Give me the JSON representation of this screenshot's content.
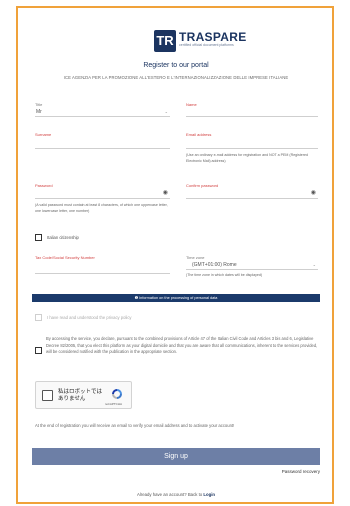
{
  "brand": {
    "logo_mark": "TR",
    "name": "TRASPARE",
    "tagline": "certified official document platforms"
  },
  "header": {
    "title": "Register to our portal",
    "subtitle": "ICE AGENZIA PER LA PROMOZIONE ALL'ESTERO E L'INTERNAZIONALIZZAZIONE DELLE IMPRESE ITALIANE"
  },
  "form": {
    "title_label": "Title",
    "title_value": "Mr",
    "name_label": "Name",
    "surname_label": "Surname",
    "email_label": "Email address",
    "email_hint": "(Use an ordinary e-mail address for registration and NOT a PEM (Registered Electronic Mail) address)",
    "password_label": "Password",
    "password_hint": "(A valid password must contain at least 8 characters, of which one uppercase letter, one lowercase letter, one number)",
    "confirm_password_label": "Confirm password",
    "italian_citizenship_label": "Italian citizenship",
    "tax_code_label": "Tax Code/Social Security Number",
    "timezone_label": "Time zone",
    "timezone_value": "(GMT+01:00) Rome",
    "timezone_hint": "(The time zone in which dates will be displayed)"
  },
  "privacy": {
    "info_bar": "Information on the processing of personal data",
    "read_label": "I have read and understood the privacy policy",
    "consent_text": "By accessing the service, you declare, pursuant to the combined provisions of Article 47 of the Italian Civil Code and Articles 3 bis and 6, Legislative Decree 82/2005, that you elect this platform as your digital domicile and that you are aware that all communications, inherent to the services provided, will be considered notified with the publication in the appropriate section."
  },
  "captcha": {
    "text": "私はロボットではありません",
    "brand": "reCAPTCHA"
  },
  "footer": {
    "note": "At the end of registration you will receive an email to verify your email address and to activate your account!",
    "signup_label": "Sign up",
    "recovery_label": "Password recovery",
    "login_prefix": "Already have an account? Back to",
    "login_link": "Login"
  },
  "colors": {
    "frame": "#f0a23a",
    "brand": "#1b3460",
    "required": "#d24040",
    "button": "#6d7fa6"
  }
}
